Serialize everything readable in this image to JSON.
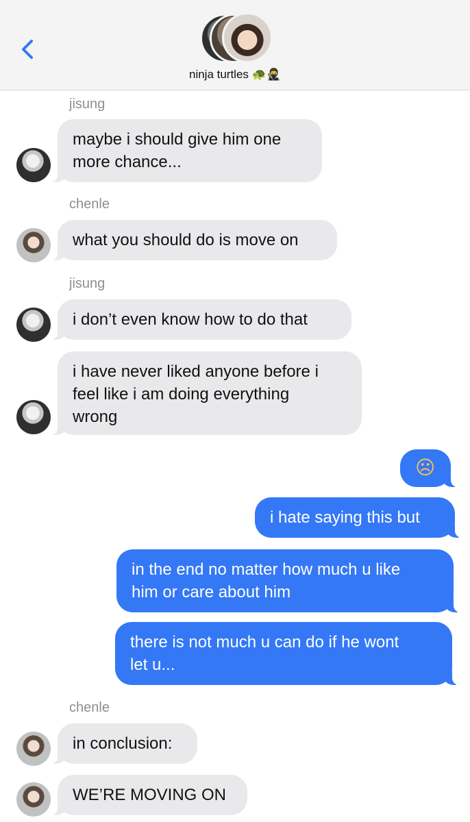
{
  "header": {
    "back_icon": "chevron-left-icon",
    "group_name": "ninja turtles",
    "group_emoji": "🐢🥷",
    "accent_color": "#3478f6"
  },
  "messages": [
    {
      "sender": "jisung",
      "text": "maybe i should give him one\nmore chance..."
    },
    {
      "sender": "chenle",
      "text": "what you should do is move on"
    },
    {
      "sender": "jisung",
      "text": "i don’t even know how to do that"
    },
    {
      "text": "i have never liked anyone before i\nfeel like i am doing everything\nwrong"
    },
    {
      "text": "☹"
    },
    {
      "text": "i hate saying this but"
    },
    {
      "text": "in the end no matter how much u like\nhim or care about him"
    },
    {
      "text": "there is not much u can do if he wont\nlet u..."
    },
    {
      "sender": "chenle",
      "text": "in conclusion:"
    },
    {
      "text": "WE’RE MOVING ON"
    }
  ]
}
